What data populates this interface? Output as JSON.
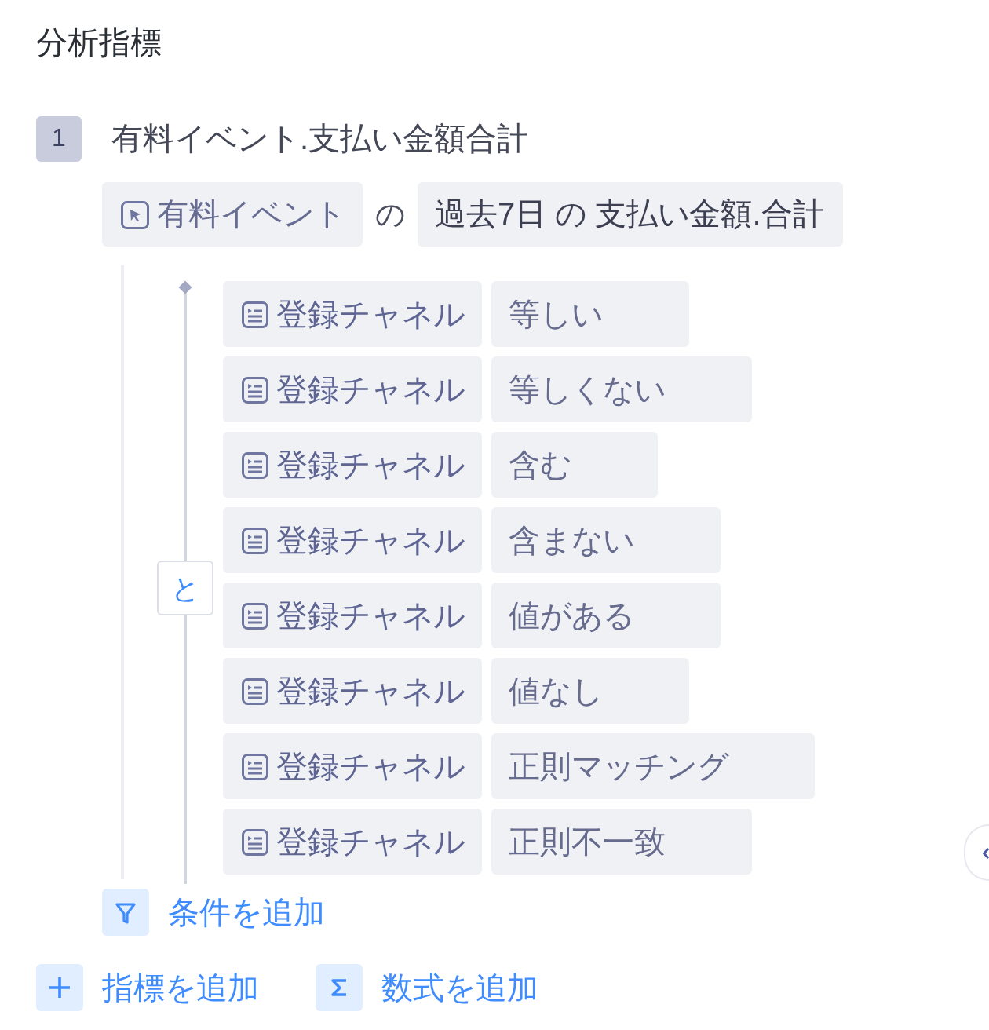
{
  "section": {
    "title": "分析指標"
  },
  "metrics": [
    {
      "index": "1",
      "name": "有料イベント.支払い金額合計",
      "event": "有料イベント",
      "joiner": "の",
      "measure": "過去7日 の 支払い金額.合計",
      "filter": {
        "logic": "と",
        "conditions": [
          {
            "field": "登録チャネル",
            "operator": "等しい"
          },
          {
            "field": "登録チャネル",
            "operator": "等しくない"
          },
          {
            "field": "登録チャネル",
            "operator": "含む"
          },
          {
            "field": "登録チャネル",
            "operator": "含まない"
          },
          {
            "field": "登録チャネル",
            "operator": "値がある"
          },
          {
            "field": "登録チャネル",
            "operator": "値なし"
          },
          {
            "field": "登録チャネル",
            "operator": "正則マッチング"
          },
          {
            "field": "登録チャネル",
            "operator": "正則不一致"
          }
        ]
      },
      "add_condition": "条件を追加"
    }
  ],
  "actions": [
    {
      "kind": "metric",
      "label": "指標を追加"
    },
    {
      "kind": "formula",
      "label": "数式を追加"
    }
  ]
}
